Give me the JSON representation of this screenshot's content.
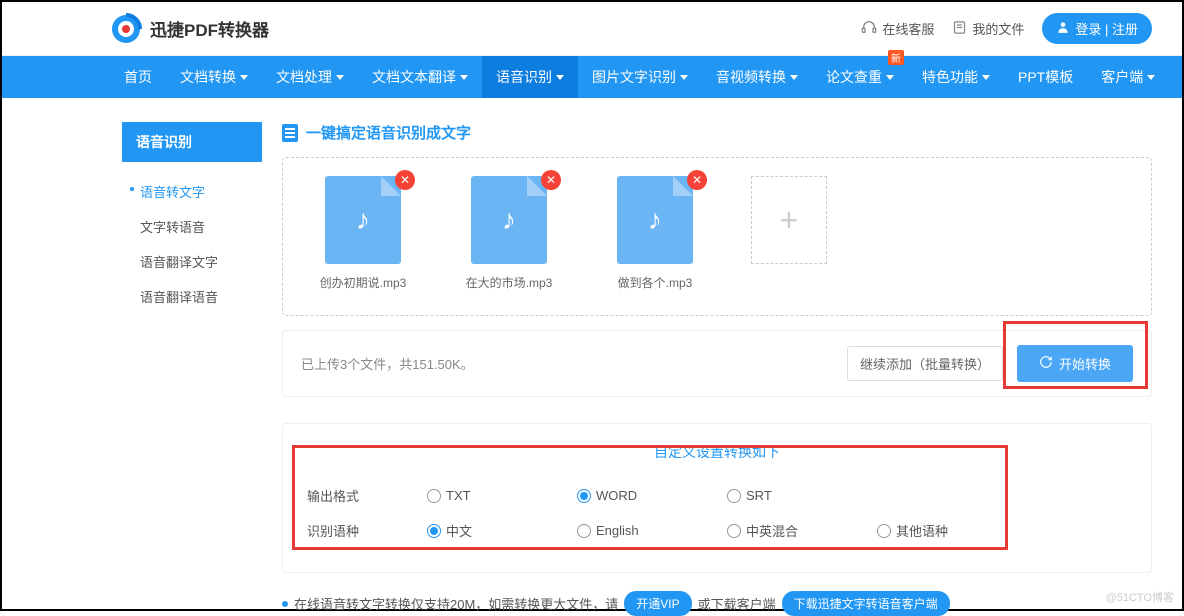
{
  "header": {
    "brand": "迅捷PDF转换器",
    "customer_service": "在线客服",
    "my_files": "我的文件",
    "login": "登录",
    "register": "注册"
  },
  "nav": {
    "items": [
      {
        "label": "首页",
        "caret": false
      },
      {
        "label": "文档转换",
        "caret": true
      },
      {
        "label": "文档处理",
        "caret": true
      },
      {
        "label": "文档文本翻译",
        "caret": true
      },
      {
        "label": "语音识别",
        "caret": true,
        "active": true
      },
      {
        "label": "图片文字识别",
        "caret": true
      },
      {
        "label": "音视频转换",
        "caret": true
      },
      {
        "label": "论文查重",
        "caret": true,
        "badge": "新"
      },
      {
        "label": "特色功能",
        "caret": true
      },
      {
        "label": "PPT模板",
        "caret": false
      },
      {
        "label": "客户端",
        "caret": true
      }
    ]
  },
  "sidebar": {
    "title": "语音识别",
    "items": [
      {
        "label": "语音转文字",
        "active": true
      },
      {
        "label": "文字转语音"
      },
      {
        "label": "语音翻译文字"
      },
      {
        "label": "语音翻译语音"
      }
    ]
  },
  "page": {
    "title": "一键搞定语音识别成文字"
  },
  "files": [
    {
      "name": "创办初期说.mp3"
    },
    {
      "name": "在大的市场.mp3"
    },
    {
      "name": "做到各个.mp3"
    }
  ],
  "status": {
    "text": "已上传3个文件，共151.50K。",
    "add_more": "继续添加（批量转换）",
    "convert": "开始转换"
  },
  "settings": {
    "title": "自定义设置转换如下",
    "format_label": "输出格式",
    "formats": [
      {
        "label": "TXT"
      },
      {
        "label": "WORD",
        "checked": true
      },
      {
        "label": "SRT"
      }
    ],
    "lang_label": "识别语种",
    "langs": [
      {
        "label": "中文",
        "checked": true
      },
      {
        "label": "English"
      },
      {
        "label": "中英混合"
      },
      {
        "label": "其他语种"
      }
    ]
  },
  "tip": {
    "text1": "在线语音转文字转换仅支持20M，如需转换更大文件，请",
    "vip": "开通VIP",
    "text2": "或下载客户端",
    "client": "下载迅捷文字转语音客户端"
  },
  "watermark": "@51CTO博客"
}
